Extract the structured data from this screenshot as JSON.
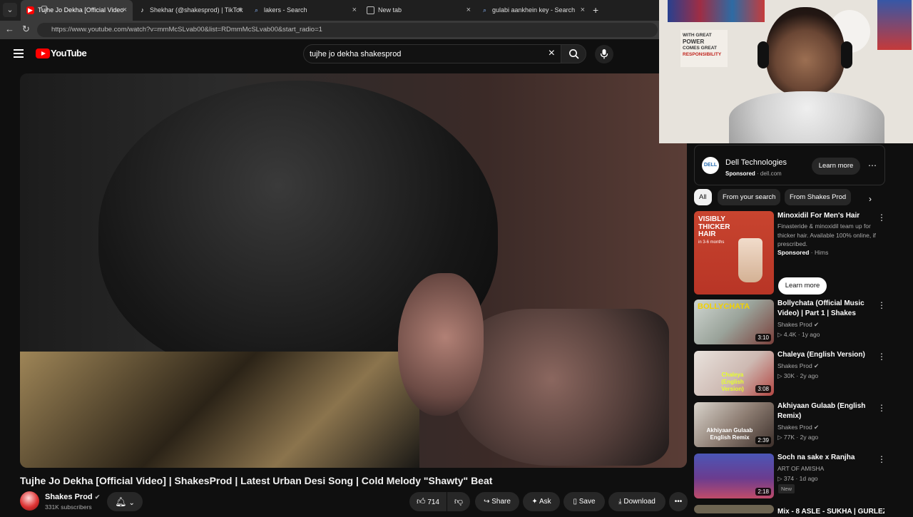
{
  "browser": {
    "tabs": [
      {
        "title": "Tujhe Jo Dekha [Official Video",
        "favicon": "youtube-icon"
      },
      {
        "title": "Shekhar (@shakesprod) | TikTok",
        "favicon": "tiktok-icon"
      },
      {
        "title": "lakers - Search",
        "favicon": "search-icon"
      },
      {
        "title": "New tab",
        "favicon": "newtab-icon"
      },
      {
        "title": "gulabi aankhein key - Search",
        "favicon": "search-icon"
      }
    ],
    "new_tab_symbol": "+",
    "url": "https://www.youtube.com/watch?v=mmMcSLvab00&list=RDmmMcSLvab00&start_radio=1"
  },
  "youtube": {
    "logo_text": "YouTube",
    "search_value": "tujhe jo dekha shakesprod",
    "video": {
      "title": "Tujhe Jo Dekha [Official Video] | ShakesProd | Latest Urban Desi Song | Cold Melody \"Shawty\" Beat",
      "channel": "Shakes Prod",
      "subscribers": "331K subscribers",
      "likes": "714",
      "actions": {
        "share": "Share",
        "ask": "Ask",
        "save": "Save",
        "download": "Download"
      }
    },
    "sidebar_ad": {
      "brand_logo_text": "DELL",
      "name": "Dell Technologies",
      "sponsored": "Sponsored",
      "domain": "dell.com",
      "button": "Learn more"
    },
    "chips": [
      "All",
      "From your search",
      "From Shakes Prod"
    ],
    "promoted": {
      "thumb_text": [
        "VISIBLY",
        "THICKER",
        "HAIR",
        "in 3-6 months"
      ],
      "title": "Minoxidil For Men's Hair",
      "desc": "Finasteride & minoxidil team up for thicker hair. Available 100% online, if prescribed.",
      "sponsored": "Sponsored",
      "advertiser": "Hims",
      "button": "Learn more"
    },
    "recommendations": [
      {
        "title": "Bollychata (Official Music Video) | Part 1 | Shakes",
        "channel": "Shakes Prod",
        "views": "4.4K",
        "age": "1y ago",
        "duration": "3:10",
        "thumb_text": "BOLLYCHATA"
      },
      {
        "title": "Chaleya (English Version)",
        "channel": "Shakes Prod",
        "views": "30K",
        "age": "2y ago",
        "duration": "3:08",
        "thumb_text": "Chaleya (English Version)"
      },
      {
        "title": "Akhiyaan Gulaab (English Remix)",
        "channel": "Shakes Prod",
        "views": "77K",
        "age": "2y ago",
        "duration": "2:39",
        "thumb_text": "Akhiyaan Gulaab English Remix"
      },
      {
        "title": "Soch na sake x Ranjha",
        "channel": "ART OF AMISHA",
        "views": "374",
        "age": "1d ago",
        "duration": "2:18",
        "badge": "New"
      }
    ],
    "next_item_title": "Mix - 8 ASLE - SUKHA | GURLEZ"
  },
  "webcam": {
    "poster_text": [
      "WITH GREAT",
      "POWER",
      "COMES GREAT",
      "RESPONSIBILITY"
    ]
  },
  "colors": {
    "accent_red": "#ff0000",
    "background": "#0f0f0f"
  }
}
